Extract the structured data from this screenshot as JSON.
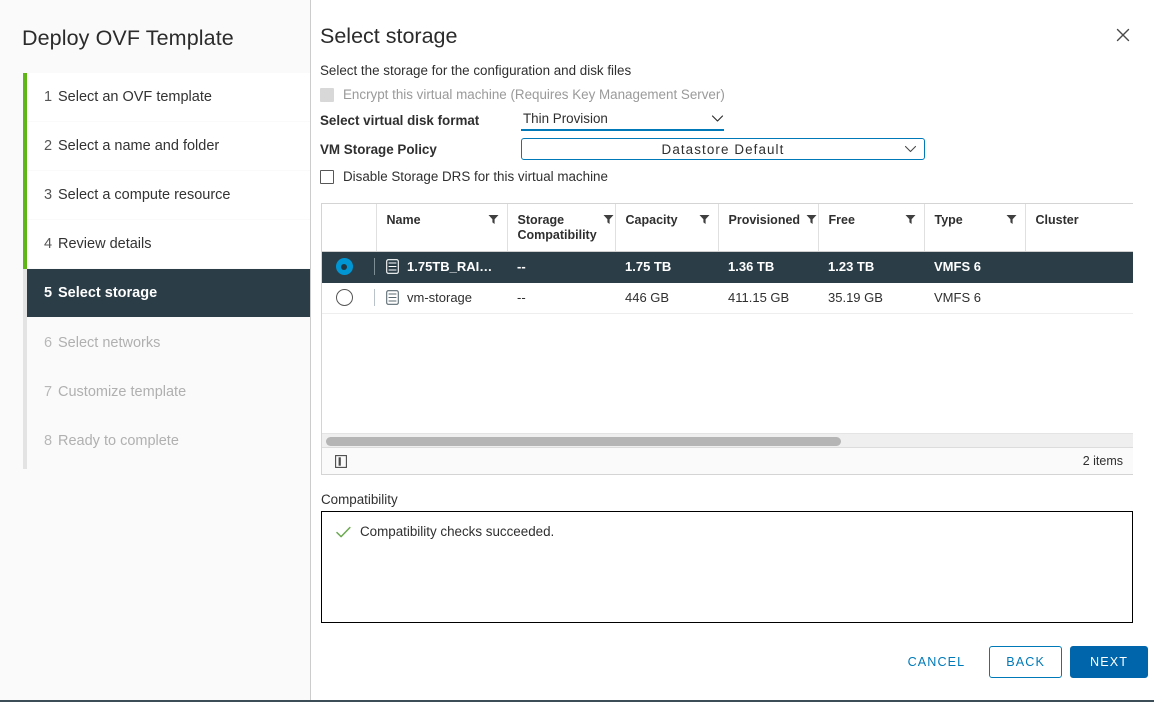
{
  "wizard": {
    "title": "Deploy OVF Template",
    "steps": [
      {
        "num": "1",
        "label": "Select an OVF template",
        "state": "done"
      },
      {
        "num": "2",
        "label": "Select a name and folder",
        "state": "done"
      },
      {
        "num": "3",
        "label": "Select a compute resource",
        "state": "done"
      },
      {
        "num": "4",
        "label": "Review details",
        "state": "done"
      },
      {
        "num": "5",
        "label": "Select storage",
        "state": "active"
      },
      {
        "num": "6",
        "label": "Select networks",
        "state": "upcoming"
      },
      {
        "num": "7",
        "label": "Customize template",
        "state": "upcoming"
      },
      {
        "num": "8",
        "label": "Ready to complete",
        "state": "upcoming"
      }
    ]
  },
  "page": {
    "title": "Select storage",
    "subtitle": "Select the storage for the configuration and disk files",
    "close_icon": "close-icon"
  },
  "form": {
    "encrypt_checkbox_label": "Encrypt this virtual machine (Requires Key Management Server)",
    "encrypt_checked": false,
    "encrypt_disabled": true,
    "disk_format_label": "Select virtual disk format",
    "disk_format_value": "Thin Provision",
    "storage_policy_label": "VM Storage Policy",
    "storage_policy_value": "Datastore Default",
    "disable_drs_label": "Disable Storage DRS for this virtual machine",
    "disable_drs_checked": false
  },
  "table": {
    "columns": [
      "Name",
      "Storage Compatibility",
      "Capacity",
      "Provisioned",
      "Free",
      "Type",
      "Cluster"
    ],
    "rows": [
      {
        "selected": true,
        "name": "1.75TB_RAI…",
        "storage_compatibility": "--",
        "capacity": "1.75 TB",
        "provisioned": "1.36 TB",
        "free": "1.23 TB",
        "type": "VMFS 6",
        "cluster": ""
      },
      {
        "selected": false,
        "name": "vm-storage",
        "storage_compatibility": "--",
        "capacity": "446 GB",
        "provisioned": "411.15 GB",
        "free": "35.19 GB",
        "type": "VMFS 6",
        "cluster": ""
      }
    ],
    "item_count": "2 items"
  },
  "compatibility": {
    "label": "Compatibility",
    "message": "Compatibility checks succeeded."
  },
  "actions": {
    "cancel": "CANCEL",
    "back": "BACK",
    "next": "NEXT"
  },
  "colors": {
    "accent_blue": "#0079b8",
    "primary_blue": "#0065ab",
    "dark_slate": "#2b3e48",
    "progress_green": "#5eb715",
    "success_green": "#6aa84f",
    "radio_blue": "#0095d3"
  }
}
